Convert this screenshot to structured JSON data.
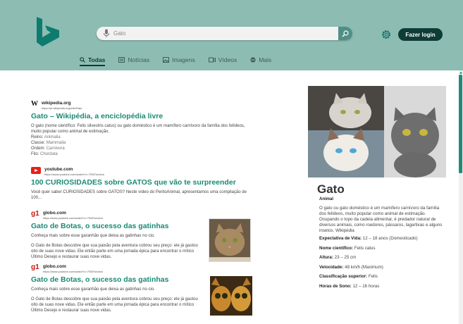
{
  "header": {
    "logo_icon": "bing-logo",
    "search": {
      "value": "Gato",
      "placeholder": ""
    },
    "login_label": "Fazer login"
  },
  "tabs": [
    {
      "label": "Todas",
      "icon": "search-icon",
      "active": true
    },
    {
      "label": "Notícias",
      "icon": "news-icon"
    },
    {
      "label": "Imagens",
      "icon": "image-icon"
    },
    {
      "label": "Vídeos",
      "icon": "video-icon"
    },
    {
      "label": "Mais",
      "icon": "more-icon"
    }
  ],
  "results": [
    {
      "site": "wikipedia.org",
      "url": "https://pt.wikipedia.org/wiki/Gato",
      "title": "Gato – Wikipédia, a enciclopédia livre",
      "desc": "O gato (nome científico: Felis silvestris catus) ou gato doméstico é um mamífero carnívoro da família dos felídeos, muito popular como animal de estimação.",
      "facts": [
        {
          "k": "Reino:",
          "v": "Animalia"
        },
        {
          "k": "Classe:",
          "v": "Mammalia"
        },
        {
          "k": "Ordem:",
          "v": "Carnivora"
        },
        {
          "k": "Filo:",
          "v": "Chordata"
        }
      ]
    },
    {
      "site": "youtube.com",
      "url": "https://www.youtube.com/watch?v=7S6f7utobvs",
      "title": "100 CURIOSIDADES sobre GATOS que vão te surpreender",
      "desc": "Você quer saber CURIOSIDADES sobre GATOS? Neste vídeo do PeritoAnimal, apresentamos uma compilação de 100..."
    },
    {
      "site": "globo.com",
      "url": "https://www.youtube.com/watch?v=7S6f7utobvs",
      "title": "Gato de Botas, o sucesso das gatinhas",
      "lead": "Conheça mais sobre esse garanhão que deixa as gatinhas no cio.",
      "desc": "O Gato de Botas descobre que sua paixão pela aventura cobrou seu preço: ele já gastou oito de suas nove vidas. Ele então parte em uma jornada épica para encontrar o mítico Último Desejo e restaurar suas nove vidas."
    },
    {
      "site": "globo.com",
      "url": "https://www.youtube.com/watch?v=7S6f7utobvs",
      "title": "Gato de Botas, o sucesso das gatinhas",
      "lead": "Conheça mais sobre esse garanhão que deixa as gatinhas no cio.",
      "desc": "O Gato de Botas descobre que sua paixão pela aventura cobrou seu preço: ele já gastou oito de suas nove vidas. Ele então parte em uma jornada épica para encontrar o mítico Último Desejo e restaurar suas nove vidas."
    }
  ],
  "panel": {
    "name": "Gato",
    "kind": "Animal",
    "desc": "O gato ou gato doméstico é um mamífero carnívoro da família dos felídeos, muito popular como animal de estimação. Ocupando o topo da cadeia alimentar, é predador natural de diversos animais, como roedores, pássaros, lagartixas e alguns insetos. Wikipédia",
    "facts": [
      {
        "k": "Expectativa de Vida:",
        "v": "12 – 18 anos (Domesticado)"
      },
      {
        "k": "Nome científico:",
        "v": "Felis catus"
      },
      {
        "k": "Altura:",
        "v": "23 – 25 cm"
      },
      {
        "k": "Velocidade:",
        "v": "48 km/h (Maximum)"
      },
      {
        "k": "Classificação superior:",
        "v": "Felis"
      },
      {
        "k": "Horas de Sono:",
        "v": "12 – 16 horas"
      }
    ]
  },
  "colors": {
    "header_bg": "#8dbcb3",
    "accent": "#1a8a76",
    "login_bg": "#0d3d36"
  }
}
